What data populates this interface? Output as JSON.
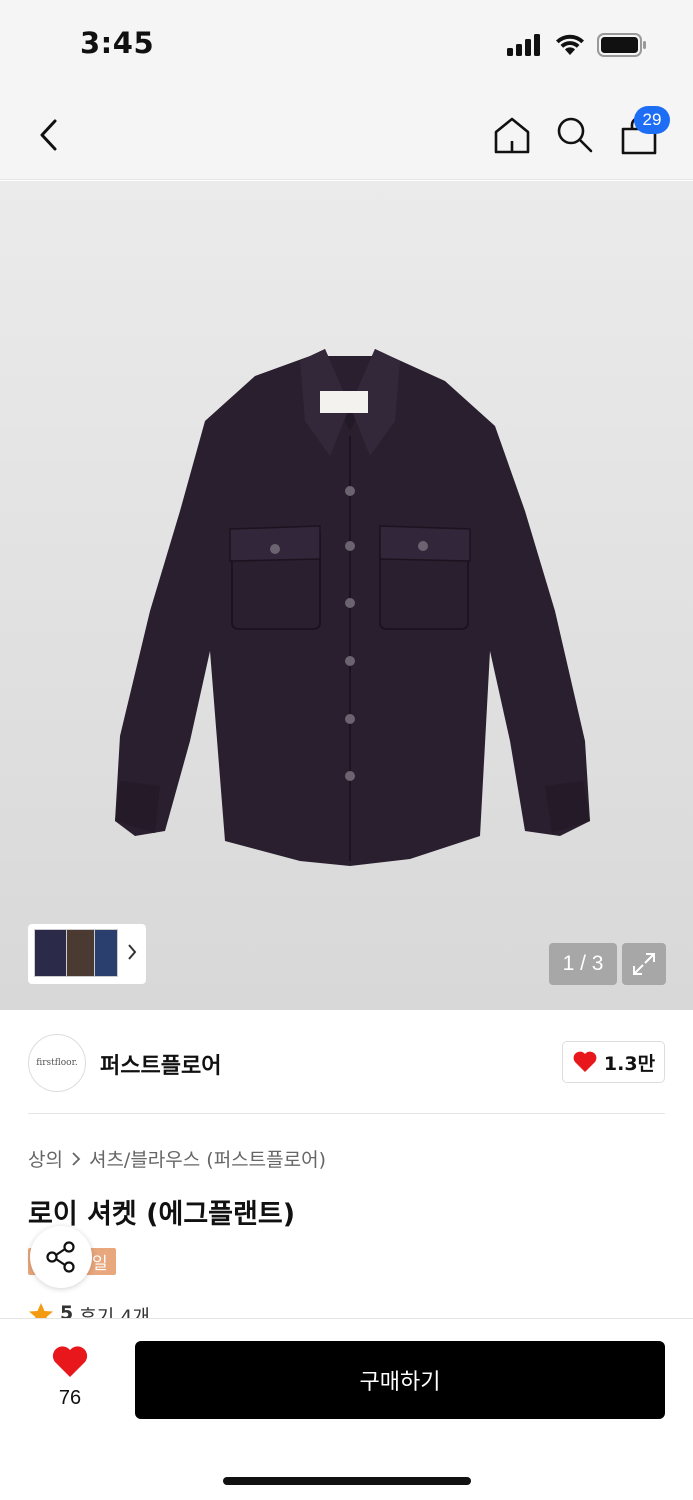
{
  "status_bar": {
    "time": "3:45"
  },
  "nav": {
    "cart_count": "29"
  },
  "gallery": {
    "page_indicator": "1 / 3"
  },
  "brand": {
    "logo_text": "firstfloor.",
    "name": "퍼스트플로어",
    "likes": "1.3만"
  },
  "breadcrumb": {
    "category": "상의",
    "subcategory": "셔츠/블라우스 (퍼스트플로어)"
  },
  "product": {
    "title": "로이 셔켓 (에그플랜트)",
    "tag": "일",
    "rating": "5",
    "reviews": "후기 4개"
  },
  "bottom": {
    "wish_count": "76",
    "buy_label": "구매하기"
  },
  "colors": {
    "accent_blue": "#1e6ef5",
    "heart_red": "#e8171b",
    "tag_orange": "#e8a77c",
    "shirt": "#2a1f2e"
  }
}
